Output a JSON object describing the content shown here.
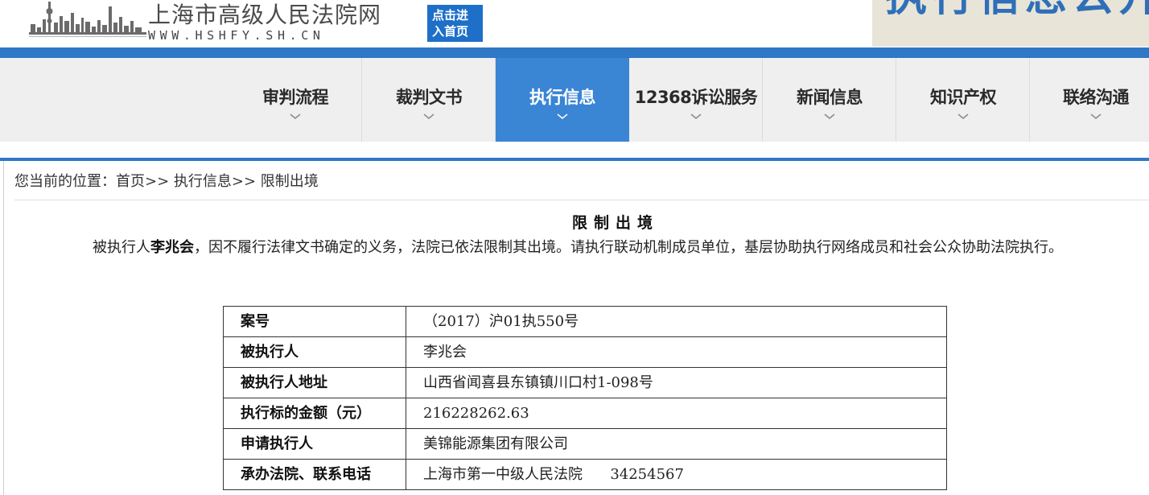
{
  "header": {
    "site_name": "上海市高级人民法院网",
    "site_url": "WWW.HSHFY.SH.CN",
    "home_button_line1": "点击进",
    "home_button_line2": "入首页",
    "banner_text": "执行信息公开"
  },
  "nav": {
    "items": [
      {
        "label": "审判流程"
      },
      {
        "label": "裁判文书"
      },
      {
        "label": "执行信息",
        "active": true
      },
      {
        "label": "12368诉讼服务"
      },
      {
        "label": "新闻信息"
      },
      {
        "label": "知识产权"
      },
      {
        "label": "联络沟通"
      }
    ]
  },
  "breadcrumb": {
    "prefix": "您当前的位置：",
    "home": "首页",
    "sep1": ">> ",
    "section": "执行信息",
    "sep2": ">> ",
    "current": "限制出境"
  },
  "notice": {
    "title": "限制出境",
    "text_before": "被执行人",
    "name": "李兆会",
    "text_after": "，因不履行法律文书确定的义务，法院已依法限制其出境。请执行联动机制成员单位，基层协助执行网络成员和社会公众协助法院执行。"
  },
  "table": {
    "rows": [
      {
        "key": "案号",
        "value": "（2017）沪01执550号"
      },
      {
        "key": "被执行人",
        "value": "李兆会"
      },
      {
        "key": "被执行人地址",
        "value": "山西省闻喜县东镇镇川口村1-098号"
      },
      {
        "key": "执行标的金额（元）",
        "value": "216228262.63"
      },
      {
        "key": "申请执行人",
        "value": "美锦能源集团有限公司"
      },
      {
        "key": "承办法院、联系电话",
        "value": "上海市第一中级人民法院      34254567"
      }
    ]
  },
  "colors": {
    "brand_blue": "#2e78c6",
    "active_nav": "#3a85d4",
    "nav_bg": "#efefef"
  }
}
